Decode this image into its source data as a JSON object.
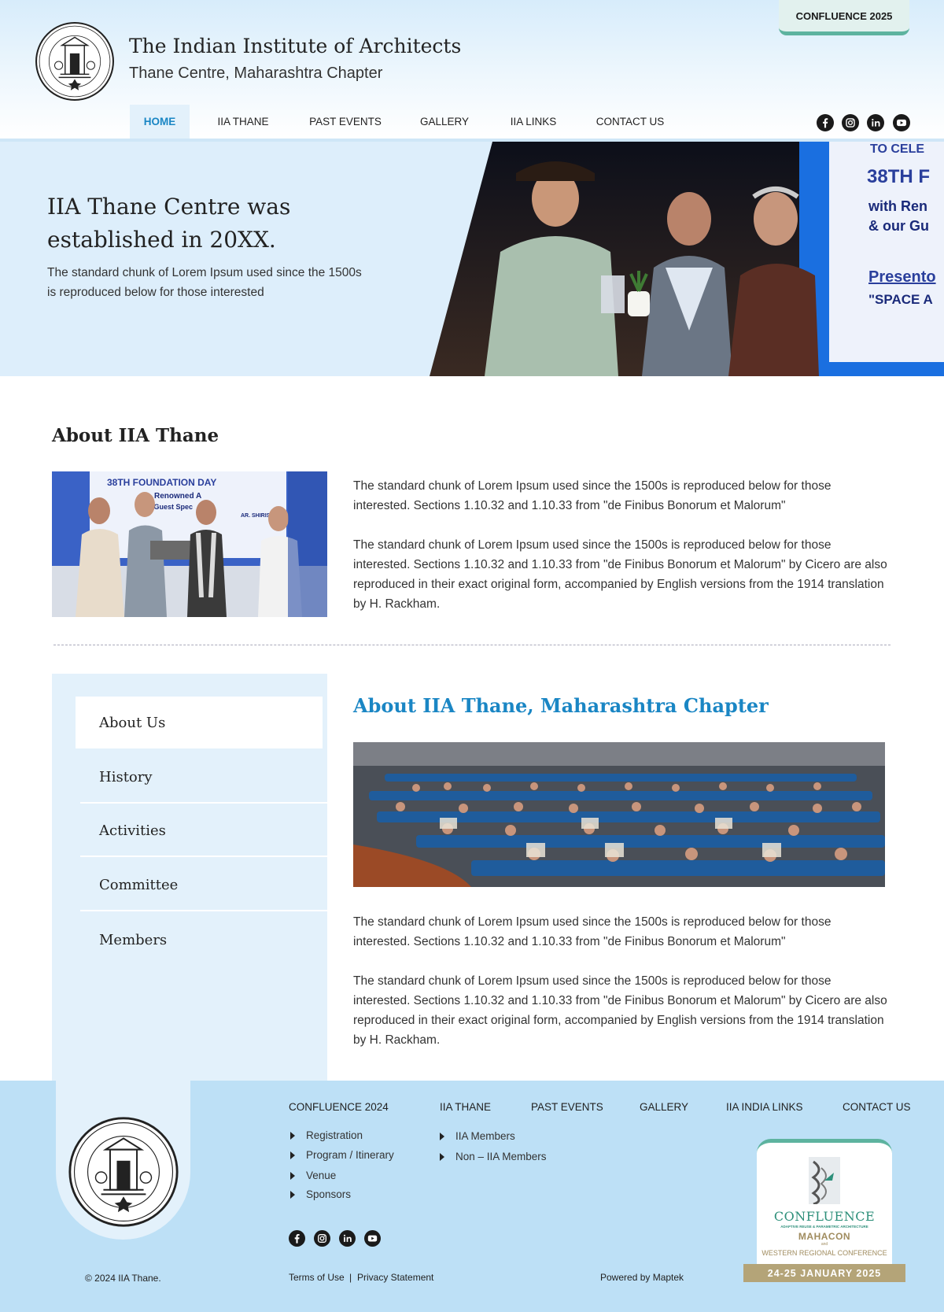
{
  "header": {
    "title": "The Indian Institute of Architects",
    "subtitle": "Thane Centre, Maharashtra Chapter",
    "confluence_tab": "CONFLUENCE 2025",
    "seal_text": "THE INDIAN INSTITUTE OF ARCHITECTS"
  },
  "nav": {
    "items": [
      {
        "label": "HOME",
        "active": true
      },
      {
        "label": "IIA THANE"
      },
      {
        "label": "PAST EVENTS"
      },
      {
        "label": "GALLERY"
      },
      {
        "label": "IIA LINKS"
      },
      {
        "label": "CONTACT US"
      }
    ],
    "social": [
      "facebook-icon",
      "instagram-icon",
      "linkedin-icon",
      "youtube-icon"
    ]
  },
  "hero": {
    "title": "IIA Thane Centre was established in 20XX.",
    "text": "The standard chunk of Lorem Ipsum used since the 1500s is reproduced below for those interested",
    "photo_banner_lines": [
      "TO CELE",
      "38TH F",
      "with Ren",
      "& our Gu",
      "Presento",
      "\"SPACE A"
    ]
  },
  "about": {
    "heading": "About IIA Thane",
    "photo_banner_lines": [
      "38TH FOUNDATION DAY",
      "Renowned A",
      "ur Guest Spec",
      "AR. SHIRISH"
    ],
    "paragraph_1": "The standard chunk of Lorem Ipsum used since the 1500s is reproduced below for those interested. Sections 1.10.32 and 1.10.33 from \"de Finibus Bonorum et Malorum\"",
    "paragraph_2": "The standard chunk of Lorem Ipsum used since the 1500s is reproduced below for those interested. Sections 1.10.32 and 1.10.33 from \"de Finibus Bonorum et Malorum\" by Cicero are also reproduced in their exact original form, accompanied by English versions from the 1914 translation by H. Rackham."
  },
  "side_menu": {
    "items": [
      {
        "label": "About Us",
        "active": true
      },
      {
        "label": "History"
      },
      {
        "label": "Activities"
      },
      {
        "label": "Committee"
      },
      {
        "label": "Members"
      }
    ]
  },
  "chapter": {
    "title": "About IIA Thane, Maharashtra Chapter",
    "paragraph_1": "The standard chunk of Lorem Ipsum used since the 1500s is reproduced below for those interested. Sections 1.10.32 and 1.10.33 from \"de Finibus Bonorum et Malorum\"",
    "paragraph_2": "The standard chunk of Lorem Ipsum used since the 1500s is reproduced below for those interested. Sections 1.10.32 and 1.10.33 from \"de Finibus Bonorum et Malorum\" by Cicero are also reproduced in their exact original form, accompanied by English versions from the 1914 translation by H. Rackham."
  },
  "footer": {
    "columns": [
      {
        "heading": "CONFLUENCE 2024",
        "links": [
          "Registration",
          "Program / Itinerary",
          "Venue",
          "Sponsors"
        ]
      },
      {
        "heading": "IIA THANE",
        "links": [
          "IIA Members",
          "Non – IIA Members"
        ]
      },
      {
        "heading": "PAST EVENTS",
        "links": []
      },
      {
        "heading": "GALLERY",
        "links": []
      },
      {
        "heading": "IIA INDIA LINKS",
        "links": []
      },
      {
        "heading": "CONTACT US",
        "links": []
      }
    ],
    "copyright": "© 2024 IIA Thane.",
    "terms": "Terms of Use",
    "separator": "|",
    "privacy": "Privacy Statement",
    "powered_by": "Powered by Maptek",
    "confluence_card": {
      "word": "CONFLUENCE",
      "sub": "ADAPTIVE REUSE & PARAMETRIC ARCHITECTURE",
      "mahacon": "MAHACON",
      "and": "and",
      "regional": "WESTERN REGIONAL CONFERENCE",
      "dates": "24-25 JANUARY 2025"
    }
  },
  "colors": {
    "accent_blue": "#1a86c4",
    "light_blue_panel": "#e3f1fb",
    "footer_blue": "#bde0f6",
    "confluence_green": "#5db39f",
    "confluence_gold": "#b4a478"
  }
}
